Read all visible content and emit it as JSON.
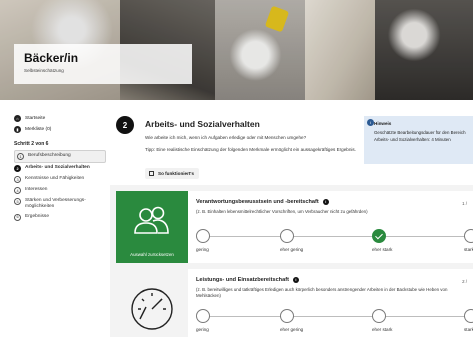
{
  "hero": {
    "title": "Bäcker/in",
    "subtitle": "Selbsteinschätzung"
  },
  "sidebar": {
    "nav": [
      {
        "label": "Startseite",
        "icon": "home-icon"
      },
      {
        "label": "Merkliste (0)",
        "icon": "bookmark-icon"
      }
    ],
    "progress_label": "Schritt 2 von 6",
    "steps": [
      {
        "num": "1",
        "label": "Berufsbeschreibung"
      },
      {
        "num": "2",
        "label": "Arbeits- und Sozialverhalten"
      },
      {
        "num": "3",
        "label": "Kenntnisse und Fähigkeiten"
      },
      {
        "num": "4",
        "label": "Interessen"
      },
      {
        "num": "5",
        "label": "Stärken und Verbesserungs-möglichkeiten"
      },
      {
        "num": "6",
        "label": "Ergebnisse"
      }
    ]
  },
  "main": {
    "section_number": "2",
    "section_title": "Arbeits- und Sozialverhalten",
    "intro": "Wie arbeite ich mich, wenn ich Aufgaben erledige oder mit Menschen umgehe?",
    "tip": "Tipp: Eine realistische Einschätzung der folgenden Merkmale ermöglicht ein aussagekräftiges Ergebnis.",
    "how_button": "So funktioniert's"
  },
  "hint": {
    "title": "Hinweis",
    "text": "Geschätzte Bearbeitungsdauer für den Bereich Arbeits- und Sozialverhalten: 4 Minuten"
  },
  "scale_labels": [
    "gering",
    "eher gering",
    "eher stark",
    "stark"
  ],
  "questions": [
    {
      "title": "Verantwortungsbewusstsein und -bereitschaft",
      "count": "1 /",
      "example": "(z. B. Einhalten lebensmittelrechtlicher Vorschriften, um Verbraucher nicht zu gefährden)",
      "selected_index": 2,
      "reset_label": "Auswahl zurücksetzen"
    },
    {
      "title": "Leistungs- und Einsatzbereitschaft",
      "count": "2 /",
      "example": "(z. B. bereitwilliges und tatkräftiges Erledigen auch körperlich besonders anstrengender Arbeiten in der Backstube wie Heben von Mehlsäcken)",
      "selected_index": -1,
      "reset_label": ""
    }
  ],
  "colors": {
    "accent_green": "#2a8a3e",
    "hint_blue": "#dfe9f5",
    "dark": "#111111"
  }
}
